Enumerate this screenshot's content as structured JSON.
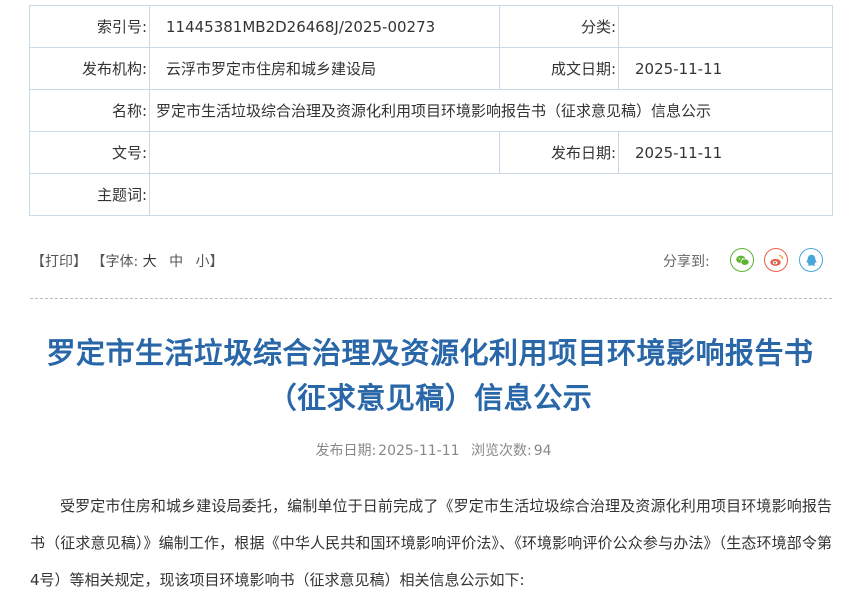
{
  "meta": {
    "index_label": "索引号:",
    "index_value": "11445381MB2D26468J/2025-00273",
    "category_label": "分类:",
    "category_value": "",
    "publisher_label": "发布机构:",
    "publisher_value": "云浮市罗定市住房和城乡建设局",
    "created_label": "成文日期:",
    "created_value": "2025-11-11",
    "name_label": "名称:",
    "name_value": "罗定市生活垃圾综合治理及资源化利用项目环境影响报告书（征求意见稿）信息公示",
    "docno_label": "文号:",
    "docno_value": "",
    "pubdate_label": "发布日期:",
    "pubdate_value": "2025-11-11",
    "subject_label": "主题词:",
    "subject_value": ""
  },
  "toolbar": {
    "print": "【打印】",
    "font_open": "【字体:",
    "font_large": "大",
    "font_medium": "中",
    "font_small": "小",
    "font_close": "】",
    "share_label": "分享到:",
    "icons": [
      "wechat-icon",
      "weibo-icon",
      "qq-icon"
    ]
  },
  "article": {
    "title": "罗定市生活垃圾综合治理及资源化利用项目环境影响报告书（征求意见稿）信息公示",
    "pub_date_label": "发布日期:",
    "pub_date": "2025-11-11",
    "views_label": "浏览次数:",
    "views": "94",
    "paragraph": "受罗定市住房和城乡建设局委托，编制单位于日前完成了《罗定市生活垃圾综合治理及资源化利用项目环境影响报告书（征求意见稿）》编制工作，根据《中华人民共和国环境影响评价法》、《环境影响评价公众参与办法》（生态环境部令第4号）等相关规定，现该项目环境影响书（征求意见稿）相关信息公示如下:"
  },
  "colors": {
    "title": "#2967a9",
    "border": "#c9d9e6",
    "wechat": "#5cb531",
    "weibo": "#e8614a",
    "qq": "#4aa6d9"
  }
}
